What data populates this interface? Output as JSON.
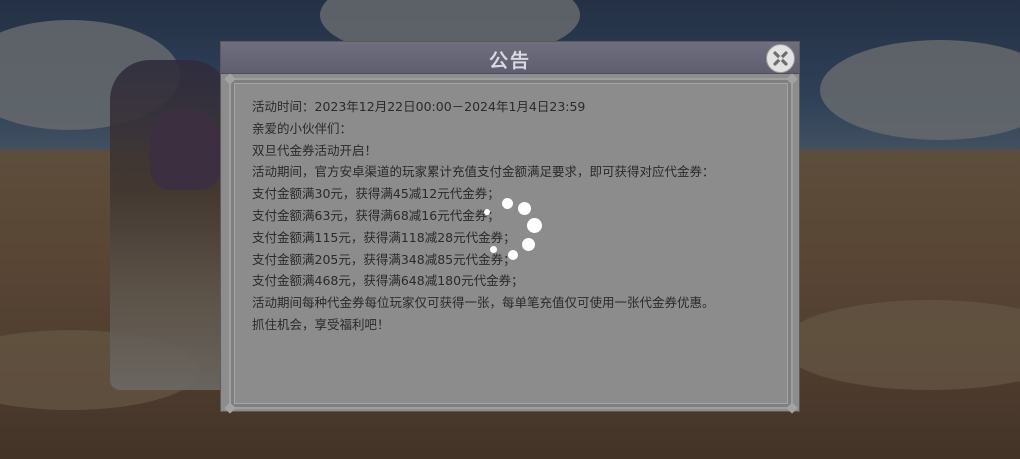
{
  "dialog": {
    "title": "公告",
    "close_icon": "close-cross-icon",
    "lines": [
      "活动时间：2023年12月22日00:00－2024年1月4日23:59",
      "亲爱的小伙伴们：",
      "双旦代金券活动开启！",
      "活动期间，官方安卓渠道的玩家累计充值支付金额满足要求，即可获得对应代金券：",
      "支付金额满30元，获得满45减12元代金券；",
      "支付金额满63元，获得满68减16元代金券；",
      "支付金额满115元，获得满118减28元代金券；",
      "支付金额满205元，获得满348减85元代金券；",
      "支付金额满468元，获得满648减180元代金券；",
      "活动期间每种代金券每位玩家仅可获得一张，每单笔充值仅可使用一张代金券优惠。",
      "抓住机会，享受福利吧！"
    ]
  },
  "loading_indicator": "loading-spinner-icon",
  "colors": {
    "header_bg": "#656475",
    "panel_bg": "#8d8d8d",
    "text": "#2a2a2a",
    "title_text": "#d8d8e0"
  }
}
